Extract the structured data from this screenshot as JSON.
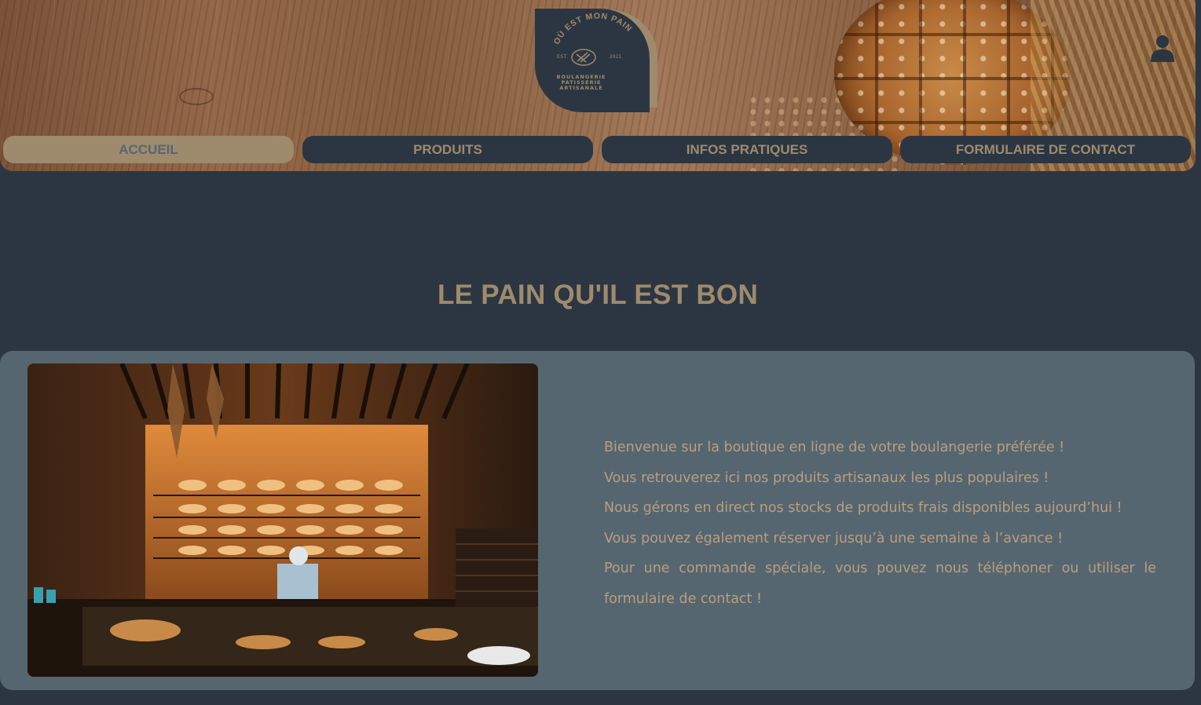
{
  "header": {
    "logo": {
      "name": "OÙ EST MON PAIN",
      "est": "EST.",
      "year": "2021.",
      "tagline_lines": [
        "BOULANGERIE",
        "PATISSERIE",
        "ARTISANALE"
      ]
    },
    "user_icon": "user-icon"
  },
  "nav": {
    "items": [
      {
        "label": "ACCUEIL",
        "active": true
      },
      {
        "label": "PRODUITS",
        "active": false
      },
      {
        "label": "INFOS PRATIQUES",
        "active": false
      },
      {
        "label": "FORMULAIRE DE CONTACT",
        "active": false
      }
    ]
  },
  "main": {
    "title": "LE PAIN QU'IL EST BON",
    "welcome_lines": [
      "Bienvenue sur la boutique en ligne de votre boulangerie préférée !",
      "Vous retrouverez ici nos produits artisanaux les plus populaires !",
      "Nous gérons en direct nos stocks de produits frais disponibles aujourd’hui !",
      "Vous pouvez également réserver jusqu’à une semaine à l’avance !",
      "Pour une commande spéciale, vous pouvez nous téléphoner ou utiliser le formulaire de contact !"
    ]
  },
  "colors": {
    "background": "#2c3642",
    "accent": "#9e8a6d",
    "card": "#566670",
    "text": "#b99e7f"
  }
}
